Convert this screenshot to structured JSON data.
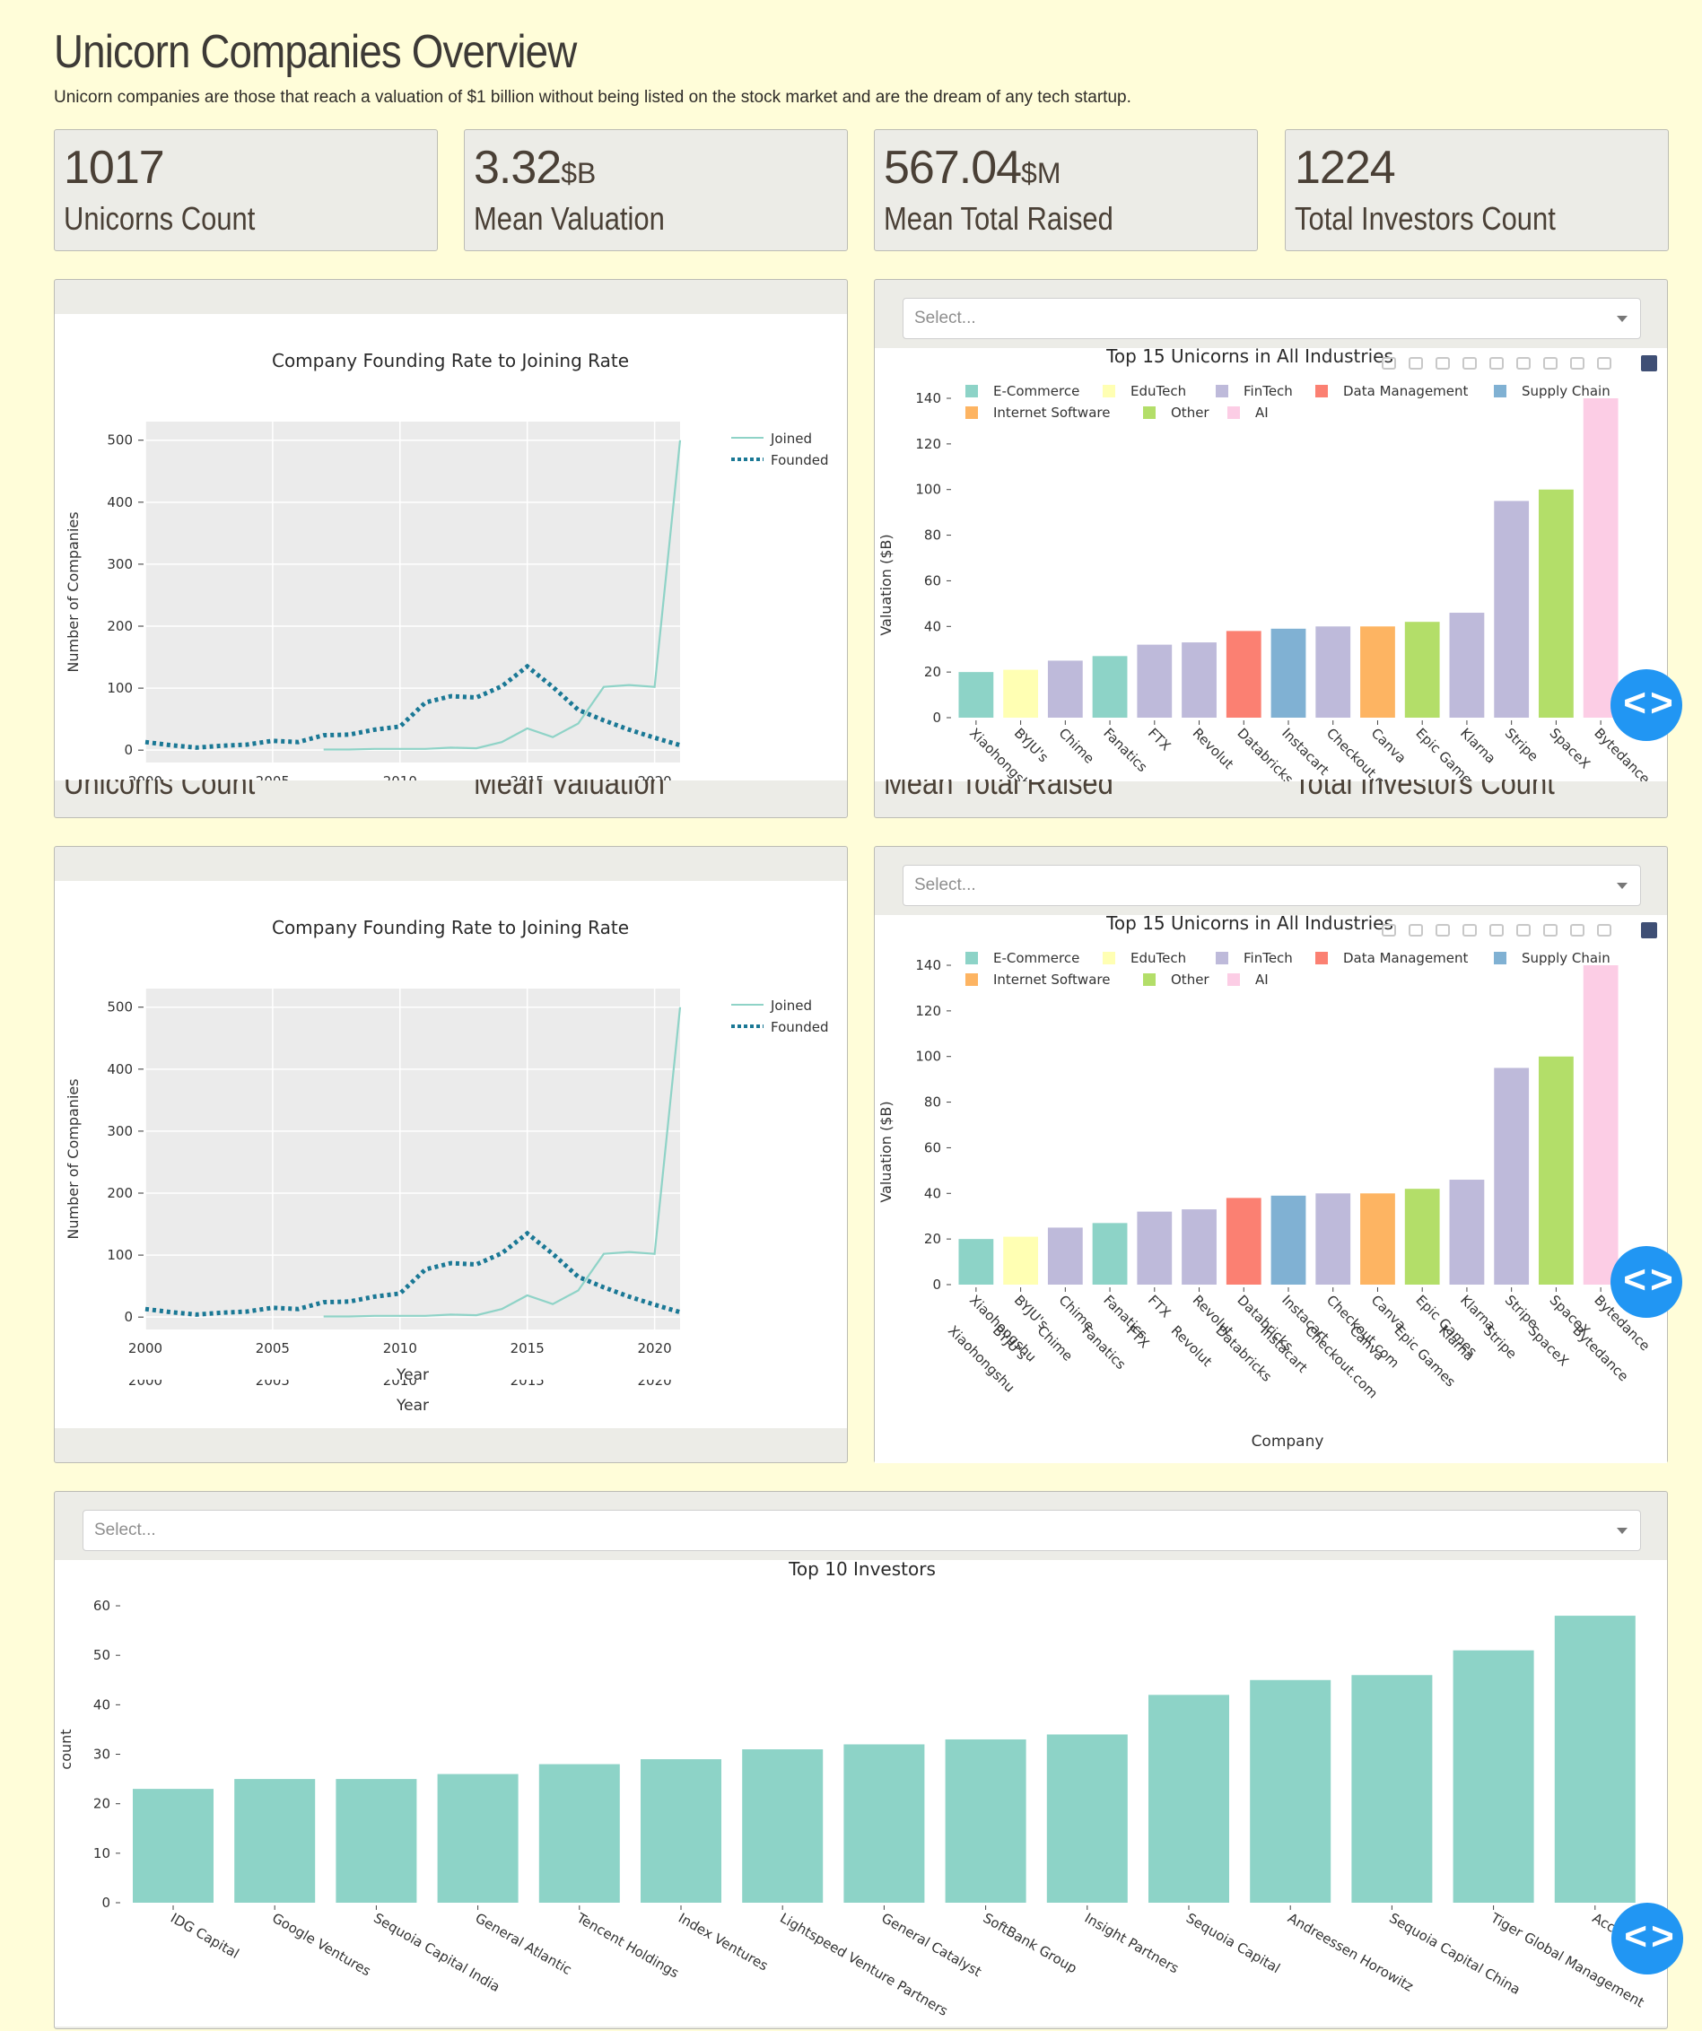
{
  "header": {
    "title": "Unicorn Companies Overview",
    "subtitle": "Unicorn companies are those that reach a valuation of $1 billion without being listed on the stock market and are the dream of any tech startup."
  },
  "kpis": [
    {
      "value": "1017",
      "unit": "",
      "label": "Unicorns Count"
    },
    {
      "value": "3.32",
      "unit": "$B",
      "label": "Mean Valuation"
    },
    {
      "value": "567.04",
      "unit": "$M",
      "label": "Mean Total Raised"
    },
    {
      "value": "1224",
      "unit": "",
      "label": "Total Investors Count"
    }
  ],
  "selects": {
    "placeholder": "Select..."
  },
  "nav_button": {
    "label": "< >"
  },
  "colors": {
    "background": "#fffdd9",
    "card": "#ecece7",
    "accent_button": "#2196f3",
    "joined_line": "#8fd3c7",
    "founded_line": "#1a7895",
    "investor_bar": "#8dd3c7"
  },
  "toolbar_icons": [
    "camera-icon",
    "zoom-icon",
    "pan-icon",
    "box-select-icon",
    "lasso-icon",
    "zoom-in-icon",
    "zoom-out-icon",
    "autoscale-icon",
    "home-icon",
    "plotly-logo-icon"
  ],
  "chart_data": [
    {
      "type": "line",
      "title": "Company Founding Rate to Joining Rate",
      "xlabel": "Year",
      "ylabel": "Number of Companies",
      "xlim": [
        2000,
        2021
      ],
      "ylim": [
        -20,
        530
      ],
      "xticks": [
        2000,
        2005,
        2010,
        2015,
        2020
      ],
      "yticks": [
        0,
        100,
        200,
        300,
        400,
        500
      ],
      "legend_position": "top-right",
      "grid": true,
      "series": [
        {
          "name": "Joined",
          "style": "solid",
          "color": "#8fd3c7",
          "x": [
            2007,
            2008,
            2009,
            2010,
            2011,
            2012,
            2013,
            2014,
            2015,
            2016,
            2017,
            2018,
            2019,
            2020,
            2021
          ],
          "y": [
            1,
            1,
            2,
            2,
            2,
            4,
            3,
            13,
            35,
            21,
            43,
            102,
            105,
            102,
            500
          ]
        },
        {
          "name": "Founded",
          "style": "dotted",
          "color": "#1a7895",
          "x": [
            2000,
            2001,
            2002,
            2003,
            2004,
            2005,
            2006,
            2007,
            2008,
            2009,
            2010,
            2011,
            2012,
            2013,
            2014,
            2015,
            2016,
            2017,
            2018,
            2019,
            2020,
            2021
          ],
          "y": [
            13,
            8,
            4,
            7,
            9,
            15,
            13,
            24,
            25,
            33,
            38,
            77,
            87,
            85,
            103,
            135,
            102,
            65,
            48,
            33,
            20,
            8
          ]
        }
      ]
    },
    {
      "type": "bar",
      "title": "Top 15 Unicorns in All Industries",
      "xlabel": "Company",
      "ylabel": "Valuation ($B)",
      "ylim": [
        0,
        140
      ],
      "yticks": [
        0,
        20,
        40,
        60,
        80,
        100,
        120,
        140
      ],
      "legend_position": "top",
      "legend": [
        {
          "name": "E-Commerce",
          "color": "#8dd3c7"
        },
        {
          "name": "EduTech",
          "color": "#ffffb3"
        },
        {
          "name": "FinTech",
          "color": "#bebada"
        },
        {
          "name": "Data Management",
          "color": "#fb8072"
        },
        {
          "name": "Supply Chain",
          "color": "#80b1d3"
        },
        {
          "name": "Internet Software",
          "color": "#fdb462"
        },
        {
          "name": "Other",
          "color": "#b3de69"
        },
        {
          "name": "AI",
          "color": "#fccde5"
        }
      ],
      "categories": [
        "Xiaohongshu",
        "BYJU's",
        "Chime",
        "Fanatics",
        "FTX",
        "Revolut",
        "Databricks",
        "Instacart",
        "Checkout.com",
        "Canva",
        "Epic Games",
        "Klarna",
        "Stripe",
        "SpaceX",
        "Bytedance"
      ],
      "values": [
        20,
        21,
        25,
        27,
        32,
        33,
        38,
        39,
        40,
        40,
        42,
        46,
        95,
        100,
        140
      ],
      "colors": [
        "#8dd3c7",
        "#ffffb3",
        "#bebada",
        "#8dd3c7",
        "#bebada",
        "#bebada",
        "#fb8072",
        "#80b1d3",
        "#bebada",
        "#fdb462",
        "#b3de69",
        "#bebada",
        "#bebada",
        "#b3de69",
        "#fccde5"
      ]
    },
    {
      "type": "bar",
      "title": "Top 10 Investors",
      "ylabel": "count",
      "ylim": [
        0,
        62
      ],
      "yticks": [
        0,
        10,
        20,
        30,
        40,
        50,
        60
      ],
      "color": "#8dd3c7",
      "categories": [
        "IDG Capital",
        "Google Ventures",
        "Sequoia Capital India",
        "General Atlantic",
        "Tencent Holdings",
        "Index Ventures",
        "Lightspeed Venture Partners",
        "General Catalyst",
        "SoftBank Group",
        "Insight Partners",
        "Sequoia Capital",
        "Andreessen Horowitz",
        "Sequoia Capital China",
        "Tiger Global Management",
        "Accel"
      ],
      "values": [
        23,
        25,
        25,
        26,
        28,
        29,
        31,
        32,
        33,
        34,
        42,
        45,
        46,
        51,
        58
      ]
    }
  ]
}
